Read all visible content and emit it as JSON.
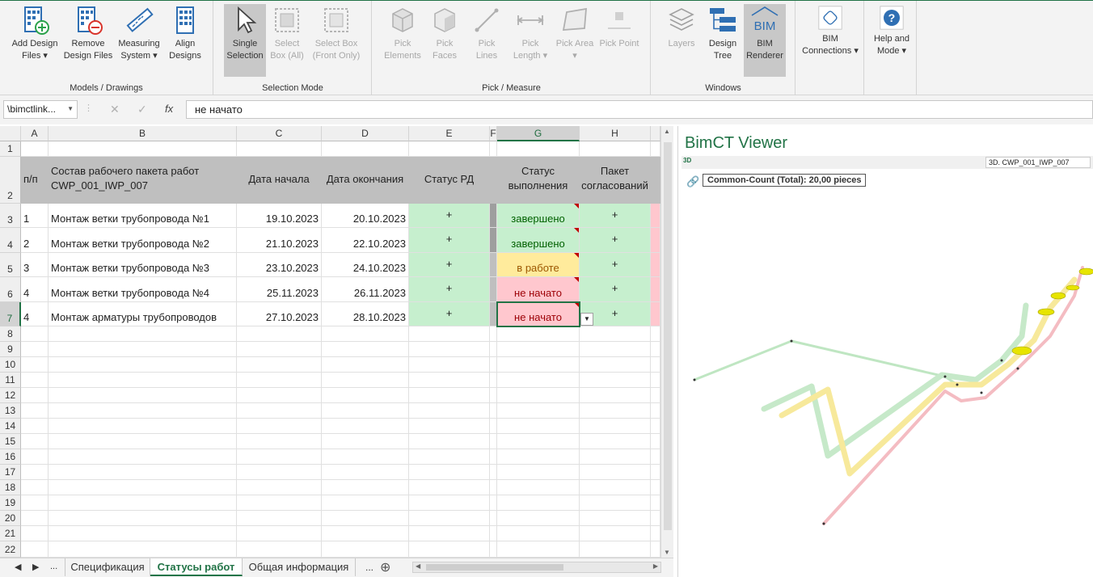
{
  "ribbon": {
    "groups": [
      {
        "label": "Models / Drawings"
      },
      {
        "label": "Selection Mode"
      },
      {
        "label": "Pick / Measure"
      },
      {
        "label": "Windows"
      }
    ],
    "buttons": {
      "add_design_files": "Add Design Files ▾",
      "remove_design_files": "Remove Design Files",
      "measuring_system": "Measuring System ▾",
      "align_designs": "Align Designs",
      "single_selection": "Single Selection",
      "select_box_all": "Select Box (All)",
      "select_box_front": "Select Box (Front Only)",
      "pick_elements": "Pick Elements",
      "pick_faces": "Pick Faces",
      "pick_lines": "Pick Lines",
      "pick_length": "Pick Length ▾",
      "pick_area": "Pick Area ▾",
      "pick_point": "Pick Point",
      "layers": "Layers",
      "design_tree": "Design Tree",
      "bim_renderer": "BIM Renderer",
      "bim_connections": "BIM Connections ▾",
      "help_mode": "Help and Mode ▾"
    }
  },
  "formula_bar": {
    "name_box": "\\bimctlink...",
    "cancel_icon": "✕",
    "enter_icon": "✓",
    "fx": "fx",
    "value": "не начато"
  },
  "columns": [
    "A",
    "B",
    "C",
    "D",
    "E",
    "F",
    "G",
    "H"
  ],
  "rows": [
    "1",
    "2",
    "3",
    "4",
    "5",
    "6",
    "7",
    "8",
    "9",
    "10",
    "11",
    "12",
    "13",
    "14",
    "15",
    "16",
    "17",
    "18",
    "19",
    "20",
    "21",
    "22"
  ],
  "table": {
    "headers": {
      "num": "п/п",
      "composition": "Состав рабочего пакета работ CWP_001_IWP_007",
      "start": "Дата начала",
      "end": "Дата окончания",
      "rd_status": "Статус РД",
      "exec_status": "Статус выполнения",
      "package": "Пакет согласований"
    },
    "rows": [
      {
        "num": "1",
        "name": "Монтаж ветки трубопровода №1",
        "start": "19.10.2023",
        "end": "20.10.2023",
        "rd": "+",
        "status": "завершено",
        "pkg": "+",
        "state": "done"
      },
      {
        "num": "2",
        "name": "Монтаж ветки трубопровода №2",
        "start": "21.10.2023",
        "end": "22.10.2023",
        "rd": "+",
        "status": "завершено",
        "pkg": "+",
        "state": "done"
      },
      {
        "num": "3",
        "name": "Монтаж ветки трубопровода №3",
        "start": "23.10.2023",
        "end": "24.10.2023",
        "rd": "+",
        "status": "в работе",
        "pkg": "+",
        "state": "progress"
      },
      {
        "num": "4",
        "name": "Монтаж ветки трубопровода №4",
        "start": "25.11.2023",
        "end": "26.11.2023",
        "rd": "+",
        "status": "не начато",
        "pkg": "+",
        "state": "todo"
      },
      {
        "num": "4",
        "name": "Монтаж арматуры трубопроводов",
        "start": "27.10.2023",
        "end": "28.10.2023",
        "rd": "+",
        "status": "не начато",
        "pkg": "+",
        "state": "todo"
      }
    ]
  },
  "sheet_tabs": {
    "more_left": "...",
    "tabs": [
      "Спецификация",
      "Статусы работ",
      "Общая информация"
    ],
    "active": "Статусы работ",
    "more_right": "...",
    "add": "⊕"
  },
  "viewer": {
    "title": "BimCT Viewer",
    "view_mode": "3D",
    "view_name": "3D. CWP_001_IWP_007",
    "count_label": "Common-Count (Total): 20,00 pieces"
  },
  "colors": {
    "accent": "#217346",
    "done_bg": "#c6efce",
    "progress_bg": "#ffeb9c",
    "todo_bg": "#ffc7ce",
    "header_bg": "#bfbfbf"
  }
}
